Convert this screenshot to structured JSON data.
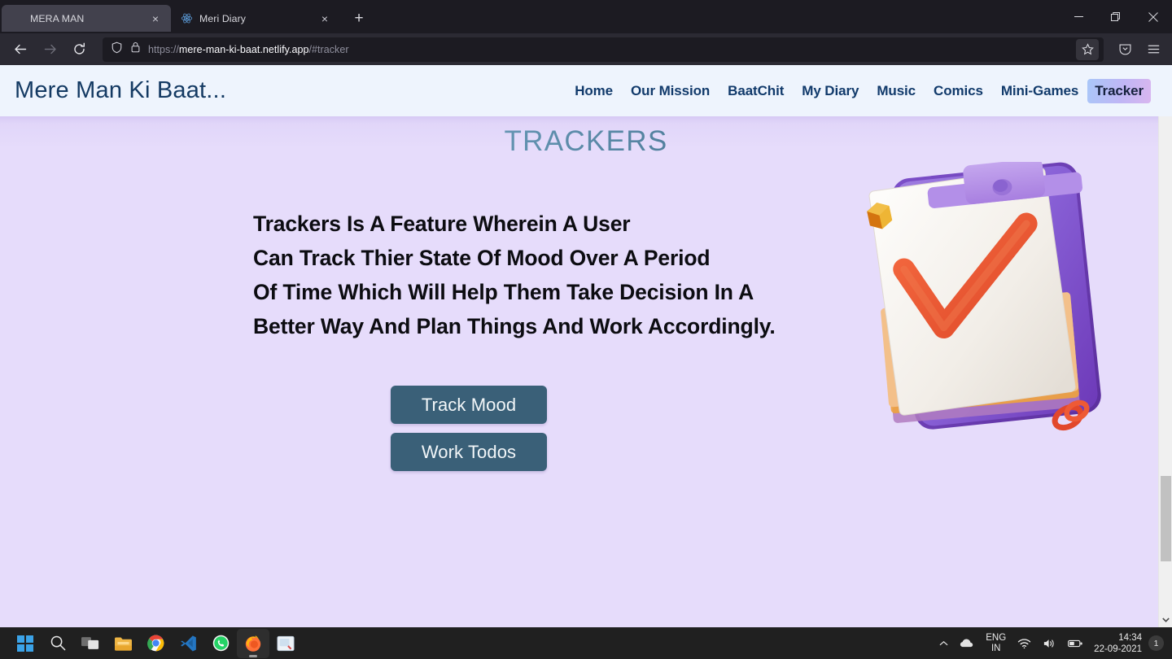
{
  "browser": {
    "tabs": [
      {
        "title": "MERA MAN",
        "favicon": "none",
        "active": true,
        "close_label": "×"
      },
      {
        "title": "Meri Diary",
        "favicon": "react-icon",
        "active": false,
        "close_label": "×"
      }
    ],
    "new_tab_label": "+",
    "window_controls": {
      "minimize": "–",
      "restore": "❐",
      "close": "×"
    },
    "toolbar": {
      "back_icon": "back-arrow-icon",
      "forward_icon": "forward-arrow-icon",
      "reload_icon": "reload-icon",
      "shield_icon": "shield-icon",
      "lock_icon": "lock-icon",
      "url_prefix": "https://",
      "url_domain": "mere-man-ki-baat.netlify.app",
      "url_suffix": "/#tracker",
      "bookmark_icon": "star-icon",
      "pocket_icon": "pocket-save-icon",
      "menu_icon": "hamburger-menu-icon"
    }
  },
  "site": {
    "logo": "Mere Man Ki Baat...",
    "nav": [
      {
        "label": "Home",
        "active": false
      },
      {
        "label": "Our Mission",
        "active": false
      },
      {
        "label": "BaatChit",
        "active": false
      },
      {
        "label": "My Diary",
        "active": false
      },
      {
        "label": "Music",
        "active": false
      },
      {
        "label": "Comics",
        "active": false
      },
      {
        "label": "Mini-Games",
        "active": false
      },
      {
        "label": "Tracker",
        "active": true
      }
    ],
    "page_title": "TRACKERS",
    "description_lines": [
      "Trackers Is A Feature Wherein A User",
      "Can Track Thier State Of Mood Over A Period",
      "Of Time Which Will Help Them Take Decision In A",
      "Better Way And Plan Things And Work Accordingly."
    ],
    "buttons": [
      {
        "label": "Track Mood"
      },
      {
        "label": "Work Todos"
      }
    ],
    "illustration": "clipboard-checkmark-3d-illustration",
    "colors": {
      "header_bg": "#eef4fd",
      "body_bg": "#e6dcfb",
      "logo_text": "#143a63",
      "nav_text": "#113a6b",
      "button_bg": "#3a6078",
      "button_text": "#f2f6f8",
      "title_gradient_from": "#9fd0e8",
      "title_gradient_to": "#32536c",
      "active_nav_gradient_from": "#a9c7f8",
      "active_nav_gradient_to": "#d9b6ef"
    }
  },
  "taskbar": {
    "apps": [
      {
        "name": "start-button",
        "running": false
      },
      {
        "name": "search-button",
        "running": false
      },
      {
        "name": "task-view-button",
        "running": false
      },
      {
        "name": "file-explorer",
        "running": false
      },
      {
        "name": "google-chrome",
        "running": false
      },
      {
        "name": "visual-studio-code",
        "running": false
      },
      {
        "name": "whatsapp",
        "running": false
      },
      {
        "name": "firefox",
        "running": true
      },
      {
        "name": "snipping-tool",
        "running": false
      }
    ],
    "tray": {
      "overflow_icon": "chevron-up-icon",
      "onedrive_icon": "cloud-icon",
      "language_line1": "ENG",
      "language_line2": "IN",
      "wifi_icon": "wifi-icon",
      "volume_icon": "speaker-icon",
      "battery_icon": "battery-icon",
      "time": "14:34",
      "date": "22-09-2021",
      "notification_count": "1"
    }
  }
}
